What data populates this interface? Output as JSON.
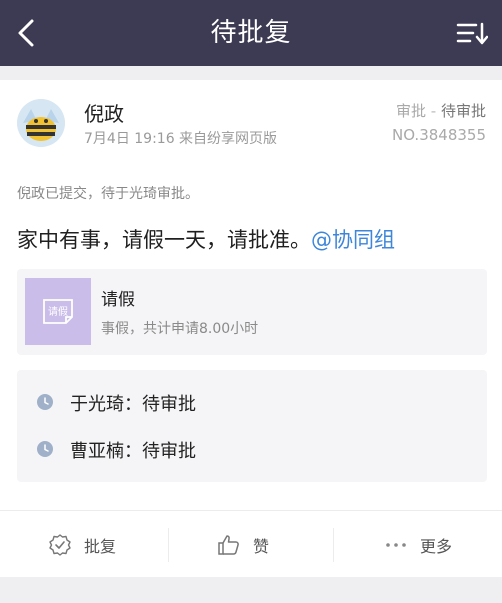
{
  "header": {
    "title": "待批复"
  },
  "post": {
    "author": "倪政",
    "meta": "7月4日 19:16 来自纷享网页版",
    "type": "审批",
    "separator": "-",
    "status": "待审批",
    "number": "NO.3848355",
    "submitted_text": "倪政已提交，待于光琦审批。",
    "content_text": "家中有事，请假一天，请批准。",
    "mention": "@协同组"
  },
  "leave": {
    "icon_text": "请假",
    "title": "请假",
    "description": "事假，共计申请8.00小时"
  },
  "approvers": [
    {
      "label": "于光琦：待审批"
    },
    {
      "label": "曹亚楠：待审批"
    }
  ],
  "actions": {
    "approve_label": "批复",
    "like_label": "赞",
    "more_label": "更多"
  },
  "colors": {
    "header_bg": "#3d3a53",
    "mention": "#3d86d9",
    "leave_icon_bg": "#cbbde9"
  }
}
